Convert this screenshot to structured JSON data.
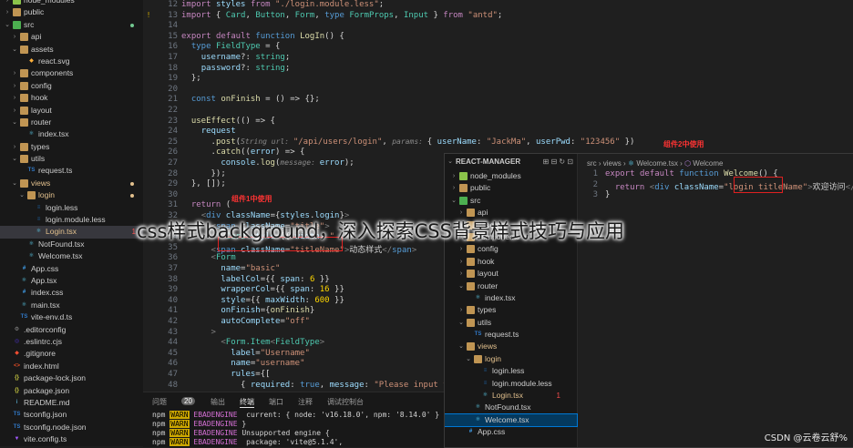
{
  "explorer": {
    "items": [
      {
        "label": "node_modules",
        "depth": 1,
        "kind": "folder-closed",
        "icon": "node-folder"
      },
      {
        "label": "public",
        "depth": 1,
        "kind": "folder-closed",
        "icon": "folder"
      },
      {
        "label": "src",
        "depth": 1,
        "kind": "folder-open",
        "icon": "src-folder",
        "dot": true
      },
      {
        "label": "api",
        "depth": 2,
        "kind": "folder-closed",
        "icon": "folder"
      },
      {
        "label": "assets",
        "depth": 2,
        "kind": "folder-open",
        "icon": "folder"
      },
      {
        "label": "react.svg",
        "depth": 3,
        "kind": "file",
        "icon": "svg"
      },
      {
        "label": "components",
        "depth": 2,
        "kind": "folder-closed",
        "icon": "folder"
      },
      {
        "label": "config",
        "depth": 2,
        "kind": "folder-closed",
        "icon": "folder"
      },
      {
        "label": "hook",
        "depth": 2,
        "kind": "folder-closed",
        "icon": "folder"
      },
      {
        "label": "layout",
        "depth": 2,
        "kind": "folder-closed",
        "icon": "folder"
      },
      {
        "label": "router",
        "depth": 2,
        "kind": "folder-open",
        "icon": "folder"
      },
      {
        "label": "index.tsx",
        "depth": 3,
        "kind": "file",
        "icon": "react"
      },
      {
        "label": "types",
        "depth": 2,
        "kind": "folder-closed",
        "icon": "folder"
      },
      {
        "label": "utils",
        "depth": 2,
        "kind": "folder-open",
        "icon": "folder"
      },
      {
        "label": "request.ts",
        "depth": 3,
        "kind": "file",
        "icon": "ts"
      },
      {
        "label": "views",
        "depth": 2,
        "kind": "folder-open",
        "icon": "folder",
        "dot": true,
        "orange": true
      },
      {
        "label": "login",
        "depth": 3,
        "kind": "folder-open",
        "icon": "folder",
        "dot": true,
        "orange": true
      },
      {
        "label": "login.less",
        "depth": 4,
        "kind": "file",
        "icon": "less"
      },
      {
        "label": "login.module.less",
        "depth": 4,
        "kind": "file",
        "icon": "less"
      },
      {
        "label": "Login.tsx",
        "depth": 4,
        "kind": "file",
        "icon": "react",
        "badge": "1",
        "orange": true,
        "selected": true
      },
      {
        "label": "NotFound.tsx",
        "depth": 3,
        "kind": "file",
        "icon": "react"
      },
      {
        "label": "Welcome.tsx",
        "depth": 3,
        "kind": "file",
        "icon": "react"
      },
      {
        "label": "App.css",
        "depth": 2,
        "kind": "file",
        "icon": "css"
      },
      {
        "label": "App.tsx",
        "depth": 2,
        "kind": "file",
        "icon": "react"
      },
      {
        "label": "index.css",
        "depth": 2,
        "kind": "file",
        "icon": "css"
      },
      {
        "label": "main.tsx",
        "depth": 2,
        "kind": "file",
        "icon": "react"
      },
      {
        "label": "vite-env.d.ts",
        "depth": 2,
        "kind": "file",
        "icon": "ts"
      },
      {
        "label": ".editorconfig",
        "depth": 1,
        "kind": "file",
        "icon": "gear"
      },
      {
        "label": ".eslintrc.cjs",
        "depth": 1,
        "kind": "file",
        "icon": "eslint"
      },
      {
        "label": ".gitignore",
        "depth": 1,
        "kind": "file",
        "icon": "git"
      },
      {
        "label": "index.html",
        "depth": 1,
        "kind": "file",
        "icon": "html"
      },
      {
        "label": "package-lock.json",
        "depth": 1,
        "kind": "file",
        "icon": "json"
      },
      {
        "label": "package.json",
        "depth": 1,
        "kind": "file",
        "icon": "json"
      },
      {
        "label": "README.md",
        "depth": 1,
        "kind": "file",
        "icon": "info"
      },
      {
        "label": "tsconfig.json",
        "depth": 1,
        "kind": "file",
        "icon": "tsconfig"
      },
      {
        "label": "tsconfig.node.json",
        "depth": 1,
        "kind": "file",
        "icon": "tsconfig"
      },
      {
        "label": "vite.config.ts",
        "depth": 1,
        "kind": "file",
        "icon": "vite"
      }
    ]
  },
  "editor": {
    "lines": [
      {
        "n": "12",
        "warn": "",
        "html": "<span class='k2'>import</span> <span class='v'>styles</span> <span class='k2'>from</span> <span class='s'>\"./login.module.less\"</span>;"
      },
      {
        "n": "13",
        "warn": "!",
        "html": "<span class='k2'>import</span> { <span class='t'>Card</span>, <span class='t'>Button</span>, <span class='t'>Form</span>, <span class='k'>type</span> <span class='t'>FormProps</span>, <span class='t'>Input</span> } <span class='k2'>from</span> <span class='s'>\"antd\"</span>;"
      },
      {
        "n": "14",
        "warn": "",
        "html": ""
      },
      {
        "n": "15",
        "warn": "",
        "html": "<span class='k2'>export</span> <span class='k2'>default</span> <span class='k'>function</span> <span class='f'>LogIn</span>() {"
      },
      {
        "n": "16",
        "warn": "",
        "html": "  <span class='k'>type</span> <span class='t'>FieldType</span> = {"
      },
      {
        "n": "17",
        "warn": "",
        "html": "    <span class='v'>username</span>?: <span class='t'>string</span>;"
      },
      {
        "n": "18",
        "warn": "",
        "html": "    <span class='v'>password</span>?: <span class='t'>string</span>;"
      },
      {
        "n": "19",
        "warn": "",
        "html": "  };"
      },
      {
        "n": "20",
        "warn": "",
        "html": ""
      },
      {
        "n": "21",
        "warn": "",
        "html": "  <span class='k'>const</span> <span class='f'>onFinish</span> = () => {};"
      },
      {
        "n": "22",
        "warn": "",
        "html": ""
      },
      {
        "n": "23",
        "warn": "",
        "html": "  <span class='f'>useEffect</span>(() => {"
      },
      {
        "n": "24",
        "warn": "",
        "html": "    <span class='v'>request</span>"
      },
      {
        "n": "25",
        "warn": "",
        "html": "      .<span class='f'>post</span>(<span class='h'>String url: </span><span class='s'>\"/api/users/login\"</span>, <span class='h'>params: </span>{ <span class='v'>userName</span>: <span class='s'>\"JackMa\"</span>, <span class='v'>userPwd</span>: <span class='s'>\"123456\"</span> })"
      },
      {
        "n": "26",
        "warn": "",
        "html": "      .<span class='f'>catch</span>((<span class='v'>error</span>) => {"
      },
      {
        "n": "27",
        "warn": "",
        "html": "        <span class='v'>console</span>.<span class='f'>log</span>(<span class='h'>message: </span><span class='v'>error</span>);"
      },
      {
        "n": "28",
        "warn": "",
        "html": "      });"
      },
      {
        "n": "29",
        "warn": "",
        "html": "  }, []);"
      },
      {
        "n": "30",
        "warn": "",
        "html": ""
      },
      {
        "n": "31",
        "warn": "",
        "html": "  <span class='k2'>return</span> ("
      },
      {
        "n": "32",
        "warn": "",
        "html": "    <span class='ang'>&lt;</span><span class='tag'>div</span> <span class='at'>className</span>={<span class='v'>styles</span>.<span class='v'>login</span>}<span class='ang'>&gt;</span>"
      },
      {
        "n": "33",
        "warn": "",
        "html": "      <span class='ang'>&lt;</span><span class='tag'>span</span> <span class='at'>className</span>=<span class='s'>\"title\"</span><span class='ang'>&gt;</span>"
      },
      {
        "n": "34",
        "warn": "",
        "html": "        <span class='ang'>&lt;</span><span class='t'>Card</span> <span class='at'>style</span>={{ <span class='v'>width</span>: <span class='s'>\"</span>"
      },
      {
        "n": "35",
        "warn": "",
        "html": "      <span class='ang'>&lt;</span><span class='tag'>span</span> <span class='at'>className</span>=<span class='s'>\"titleName\"</span><span class='ang'>&gt;</span>动态样式<span class='ang'>&lt;/</span><span class='tag'>span</span><span class='ang'>&gt;</span>"
      },
      {
        "n": "36",
        "warn": "",
        "html": "      <span class='ang'>&lt;</span><span class='t'>Form</span>"
      },
      {
        "n": "37",
        "warn": "",
        "html": "        <span class='at'>name</span>=<span class='s'>\"basic\"</span>"
      },
      {
        "n": "38",
        "warn": "",
        "html": "        <span class='at'>labelCol</span>={{ <span class='v'>span</span>: <span class='b'>6</span> }}"
      },
      {
        "n": "39",
        "warn": "",
        "html": "        <span class='at'>wrapperCol</span>={{ <span class='v'>span</span>: <span class='b'>16</span> }}"
      },
      {
        "n": "40",
        "warn": "",
        "html": "        <span class='at'>style</span>={{ <span class='v'>maxWidth</span>: <span class='b'>600</span> }}"
      },
      {
        "n": "41",
        "warn": "",
        "html": "        <span class='at'>onFinish</span>={<span class='f'>onFinish</span>}"
      },
      {
        "n": "42",
        "warn": "",
        "html": "        <span class='at'>autoComplete</span>=<span class='s'>\"off\"</span>"
      },
      {
        "n": "43",
        "warn": "",
        "html": "      <span class='ang'>&gt;</span>"
      },
      {
        "n": "44",
        "warn": "",
        "html": "        <span class='ang'>&lt;</span><span class='t'>Form.Item</span><span class='ang'>&lt;</span><span class='t'>FieldType</span><span class='ang'>&gt;</span>"
      },
      {
        "n": "45",
        "warn": "",
        "html": "          <span class='at'>label</span>=<span class='s'>\"Username\"</span>"
      },
      {
        "n": "46",
        "warn": "",
        "html": "          <span class='at'>name</span>=<span class='s'>\"username\"</span>"
      },
      {
        "n": "47",
        "warn": "",
        "html": "          <span class='at'>rules</span>={["
      },
      {
        "n": "48",
        "warn": "",
        "html": "            { <span class='v'>required</span>: <span class='k'>true</span>, <span class='v'>message</span>: <span class='s'>\"Please input you</span>"
      }
    ],
    "annotation_label": "组件1中使用"
  },
  "panel": {
    "tabs": [
      "问题",
      "20",
      "输出",
      "终端",
      "端口",
      "注释",
      "调试控制台"
    ],
    "active_tab": "终端",
    "lines": [
      {
        "prefix": "npm",
        "badge": "WARN",
        "tag": "EBADENGINE",
        "text": "  current: { node: 'v16.18.0', npm: '8.14.0' }"
      },
      {
        "prefix": "npm",
        "badge": "WARN",
        "tag": "EBADENGINE",
        "text": " }"
      },
      {
        "prefix": "npm",
        "badge": "WARN",
        "tag": "EBADENGINE",
        "text": " Unsupported engine {"
      },
      {
        "prefix": "npm",
        "badge": "WARN",
        "tag": "EBADENGINE",
        "text": "  package: 'vite@5.1.4',"
      }
    ]
  },
  "overlay": {
    "explorer_title": "REACT-MANAGER",
    "items": [
      {
        "label": "node_modules",
        "depth": 1,
        "open": false,
        "icon": "node-folder"
      },
      {
        "label": "public",
        "depth": 1,
        "open": false,
        "icon": "folder"
      },
      {
        "label": "src",
        "depth": 1,
        "open": true,
        "icon": "src-folder"
      },
      {
        "label": "api",
        "depth": 2,
        "open": false,
        "icon": "folder"
      },
      {
        "label": "assets",
        "depth": 2,
        "open": false,
        "icon": "folder"
      },
      {
        "label": "components",
        "depth": 2,
        "open": false,
        "icon": "folder"
      },
      {
        "label": "config",
        "depth": 2,
        "open": false,
        "icon": "folder"
      },
      {
        "label": "hook",
        "depth": 2,
        "open": false,
        "icon": "folder"
      },
      {
        "label": "layout",
        "depth": 2,
        "open": false,
        "icon": "folder"
      },
      {
        "label": "router",
        "depth": 2,
        "open": true,
        "icon": "folder"
      },
      {
        "label": "index.tsx",
        "depth": 3,
        "file": true,
        "icon": "react"
      },
      {
        "label": "types",
        "depth": 2,
        "open": false,
        "icon": "folder"
      },
      {
        "label": "utils",
        "depth": 2,
        "open": true,
        "icon": "folder"
      },
      {
        "label": "request.ts",
        "depth": 3,
        "file": true,
        "icon": "ts"
      },
      {
        "label": "views",
        "depth": 2,
        "open": true,
        "icon": "folder",
        "orange": true
      },
      {
        "label": "login",
        "depth": 3,
        "open": true,
        "icon": "folder",
        "orange": true
      },
      {
        "label": "login.less",
        "depth": 4,
        "file": true,
        "icon": "less"
      },
      {
        "label": "login.module.less",
        "depth": 4,
        "file": true,
        "icon": "less"
      },
      {
        "label": "Login.tsx",
        "depth": 4,
        "file": true,
        "icon": "react",
        "orange": true,
        "badge": "1"
      },
      {
        "label": "NotFound.tsx",
        "depth": 3,
        "file": true,
        "icon": "react"
      },
      {
        "label": "Welcome.tsx",
        "depth": 3,
        "file": true,
        "icon": "react",
        "selected": true
      },
      {
        "label": "App.css",
        "depth": 2,
        "file": true,
        "icon": "css"
      }
    ],
    "breadcrumb": [
      "src",
      "views",
      "Welcome.tsx",
      "Welcome"
    ],
    "annotation_label": "组件2中使用",
    "lines": [
      {
        "n": "1",
        "html": "<span class='k2'>export</span> <span class='k2'>default</span> <span class='k'>function</span> <span class='f'>Welcome</span>() {"
      },
      {
        "n": "2",
        "html": "  <span class='k2'>return</span> <span class='ang'>&lt;</span><span class='tag'>div</span> <span class='at'>className</span>=<span class='s'>\"login titleName\"</span><span class='ang'>&gt;</span>欢迎访问<span class='ang'>&lt;/</span><span class='tag'>div</span><span class='ang'>&gt;</span>"
      },
      {
        "n": "3",
        "html": "}"
      }
    ]
  },
  "caption": "css样式background，深入探索CSS背景样式技巧与应用",
  "watermark": "CSDN @云卷云舒%"
}
